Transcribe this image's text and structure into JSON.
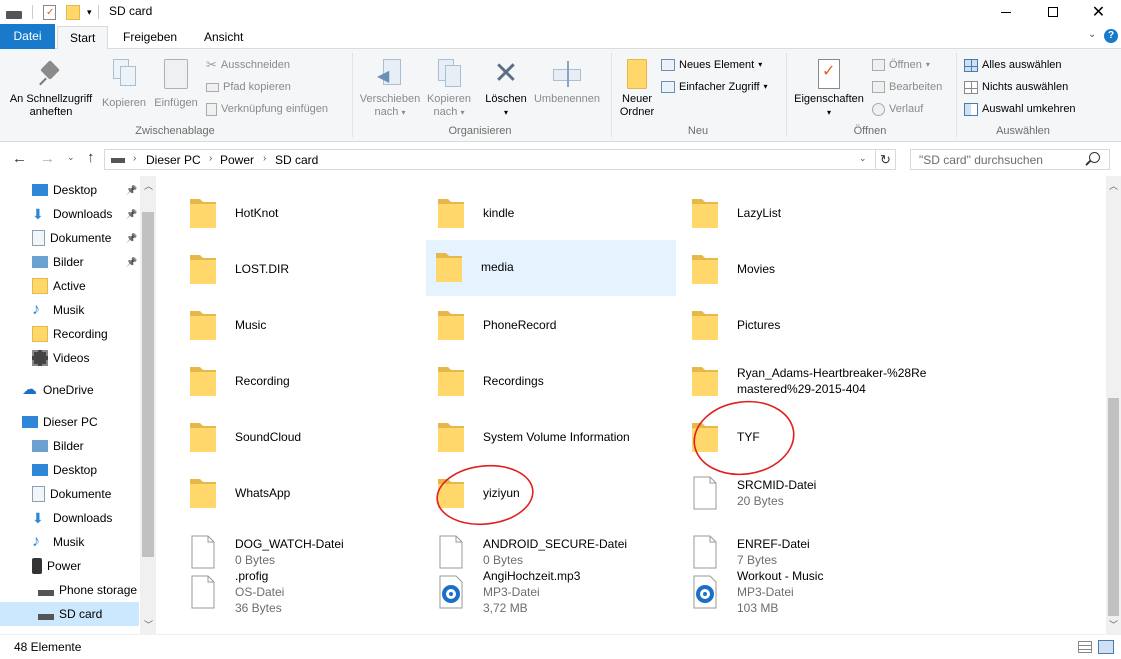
{
  "window": {
    "title": "SD card"
  },
  "ribbon_tabs": [
    "Datei",
    "Start",
    "Freigeben",
    "Ansicht"
  ],
  "ribbon": {
    "clipboard": {
      "pin": "An Schnellzugriff anheften",
      "copy": "Kopieren",
      "paste": "Einfügen",
      "cut": "Ausschneiden",
      "copy_path": "Pfad kopieren",
      "paste_shortcut": "Verknüpfung einfügen",
      "label": "Zwischenablage"
    },
    "organize": {
      "move_to_1": "Verschieben",
      "move_to_2": "nach",
      "copy_to_1": "Kopieren",
      "copy_to_2": "nach",
      "delete": "Löschen",
      "rename": "Umbenennen",
      "label": "Organisieren"
    },
    "new": {
      "new_folder_1": "Neuer",
      "new_folder_2": "Ordner",
      "new_item": "Neues Element",
      "easy_access": "Einfacher Zugriff",
      "label": "Neu"
    },
    "open": {
      "properties": "Eigenschaften",
      "open": "Öffnen",
      "edit": "Bearbeiten",
      "history": "Verlauf",
      "label": "Öffnen"
    },
    "select": {
      "select_all": "Alles auswählen",
      "select_none": "Nichts auswählen",
      "invert": "Auswahl umkehren",
      "label": "Auswählen"
    }
  },
  "address": {
    "crumbs": [
      "Dieser PC",
      "Power",
      "SD card"
    ],
    "search_placeholder": "\"SD card\" durchsuchen"
  },
  "nav": [
    {
      "label": "Desktop",
      "icon": "desktop-icon",
      "pinned": true
    },
    {
      "label": "Downloads",
      "icon": "download-icon",
      "pinned": true
    },
    {
      "label": "Dokumente",
      "icon": "document-icon",
      "pinned": true
    },
    {
      "label": "Bilder",
      "icon": "pictures-icon",
      "pinned": true
    },
    {
      "label": "Active",
      "icon": "folder-icon"
    },
    {
      "label": "Musik",
      "icon": "music-icon"
    },
    {
      "label": "Recording",
      "icon": "folder-icon"
    },
    {
      "label": "Videos",
      "icon": "video-icon"
    },
    {
      "label": "OneDrive",
      "icon": "cloud-icon"
    },
    {
      "label": "Dieser PC",
      "icon": "computer-icon"
    },
    {
      "label": "Bilder",
      "icon": "pictures-icon"
    },
    {
      "label": "Desktop",
      "icon": "desktop-icon"
    },
    {
      "label": "Dokumente",
      "icon": "document-icon"
    },
    {
      "label": "Downloads",
      "icon": "download-icon"
    },
    {
      "label": "Musik",
      "icon": "music-icon"
    },
    {
      "label": "Power",
      "icon": "device-icon"
    },
    {
      "label": "Phone storage",
      "icon": "drive-icon"
    },
    {
      "label": "SD card",
      "icon": "drive-icon",
      "selected": true
    }
  ],
  "items": [
    {
      "name": "HotKnot",
      "type": "folder"
    },
    {
      "name": "kindle",
      "type": "folder"
    },
    {
      "name": "LazyList",
      "type": "folder"
    },
    {
      "name": "LOST.DIR",
      "type": "folder"
    },
    {
      "name": "media",
      "type": "folder",
      "hover": true
    },
    {
      "name": "Movies",
      "type": "folder"
    },
    {
      "name": "Music",
      "type": "folder"
    },
    {
      "name": "PhoneRecord",
      "type": "folder"
    },
    {
      "name": "Pictures",
      "type": "folder"
    },
    {
      "name": "Recording",
      "type": "folder"
    },
    {
      "name": "Recordings",
      "type": "folder"
    },
    {
      "name": "Ryan_Adams-Heartbreaker-%28Re",
      "name2": "mastered%29-2015-404",
      "type": "folder"
    },
    {
      "name": "SoundCloud",
      "type": "folder"
    },
    {
      "name": "System Volume Information",
      "type": "folder"
    },
    {
      "name": "TYF",
      "type": "folder",
      "circled": true
    },
    {
      "name": "WhatsApp",
      "type": "folder"
    },
    {
      "name": "yiziyun",
      "type": "folder",
      "circled": true
    },
    {
      "name": "SRCMID-Datei",
      "sub1": "20 Bytes",
      "type": "file"
    },
    {
      "name": "DOG_WATCH-Datei",
      "sub1": "0 Bytes",
      "type": "file"
    },
    {
      "name": "ANDROID_SECURE-Datei",
      "sub1": "0 Bytes",
      "type": "file"
    },
    {
      "name": "ENREF-Datei",
      "sub1": "7 Bytes",
      "type": "file"
    },
    {
      "name": ".profig",
      "sub1": "OS-Datei",
      "sub2": "36 Bytes",
      "type": "file"
    },
    {
      "name": "AngiHochzeit.mp3",
      "sub1": "MP3-Datei",
      "sub2": "3,72 MB",
      "type": "audio"
    },
    {
      "name": "Workout - Music",
      "sub1": "MP3-Datei",
      "sub2": "103 MB",
      "type": "audio"
    }
  ],
  "status": {
    "count": "48 Elemente"
  },
  "colors": {
    "accent": "#1979ca",
    "folder": "#ffd76b",
    "annotation": "#e02020"
  }
}
